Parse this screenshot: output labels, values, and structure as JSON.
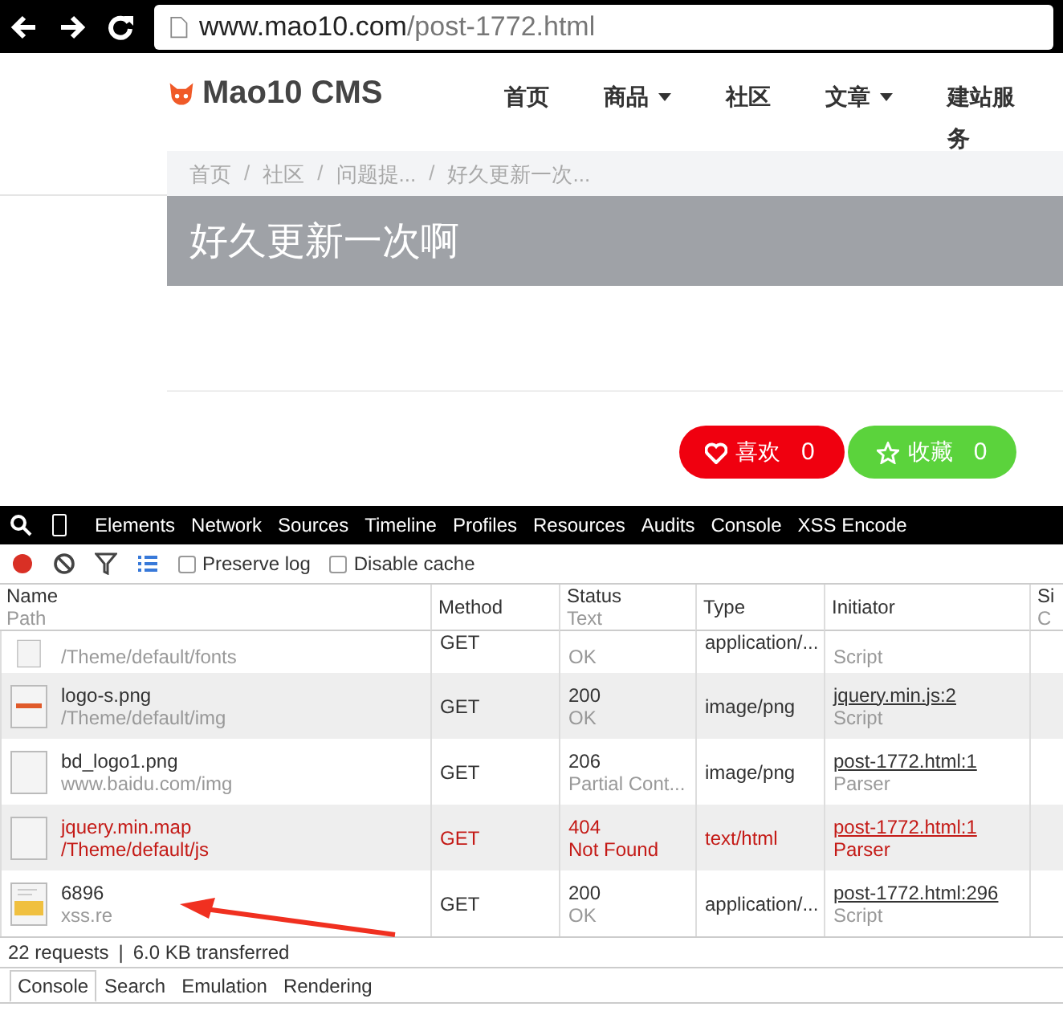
{
  "browser": {
    "url_host": "www.mao10.com",
    "url_path": "/post-1772.html"
  },
  "site": {
    "logo_text": "Mao10 CMS",
    "nav": [
      {
        "label": "首页",
        "has_menu": false
      },
      {
        "label": "商品",
        "has_menu": true
      },
      {
        "label": "社区",
        "has_menu": false
      },
      {
        "label": "文章",
        "has_menu": true
      },
      {
        "label": "建站服务",
        "has_menu": false
      }
    ],
    "breadcrumb": [
      "首页",
      "社区",
      "问题提...",
      "好久更新一次..."
    ],
    "breadcrumb_separators": [
      "/",
      "/",
      "/"
    ],
    "title": "好久更新一次啊",
    "actions": [
      {
        "kind": "like",
        "label": "喜欢",
        "count": "0"
      },
      {
        "kind": "favorite",
        "label": "收藏",
        "count": "0"
      }
    ]
  },
  "devtools": {
    "panels": [
      "Elements",
      "Network",
      "Sources",
      "Timeline",
      "Profiles",
      "Resources",
      "Audits",
      "Console",
      "XSS Encode"
    ],
    "options": [
      {
        "label": "Preserve log",
        "checked": false
      },
      {
        "label": "Disable cache",
        "checked": false
      }
    ],
    "columns": [
      {
        "title": "Name",
        "subtitle": "Path"
      },
      {
        "title": "Method"
      },
      {
        "title": "Status",
        "subtitle": "Text"
      },
      {
        "title": "Type"
      },
      {
        "title": "Initiator"
      },
      {
        "title": "Si",
        "subtitle": "C"
      }
    ],
    "rows": [
      {
        "kind": "file",
        "partial": true,
        "name": "",
        "path": "/Theme/default/fonts",
        "method": "GET",
        "status": "",
        "status_text": "OK",
        "type": "application/...",
        "initiator": "",
        "initiator_kind": "Script",
        "error": false
      },
      {
        "kind": "image",
        "partial": false,
        "name": "logo-s.png",
        "path": "/Theme/default/img",
        "method": "GET",
        "status": "200",
        "status_text": "OK",
        "type": "image/png",
        "initiator": "jquery.min.js:2",
        "initiator_kind": "Script",
        "error": false
      },
      {
        "kind": "file",
        "partial": false,
        "name": "bd_logo1.png",
        "path": "www.baidu.com/img",
        "method": "GET",
        "status": "206",
        "status_text": "Partial Cont...",
        "type": "image/png",
        "initiator": "post-1772.html:1",
        "initiator_kind": "Parser",
        "error": false
      },
      {
        "kind": "file",
        "partial": false,
        "name": "jquery.min.map",
        "path": "/Theme/default/js",
        "method": "GET",
        "status": "404",
        "status_text": "Not Found",
        "type": "text/html",
        "initiator": "post-1772.html:1",
        "initiator_kind": "Parser",
        "error": true
      },
      {
        "kind": "script",
        "partial": false,
        "name": "6896",
        "path": "xss.re",
        "method": "GET",
        "status": "200",
        "status_text": "OK",
        "type": "application/...",
        "initiator": "post-1772.html:296",
        "initiator_kind": "Script",
        "error": false
      }
    ],
    "summary": [
      "22 requests",
      "|",
      "6.0 KB transferred"
    ],
    "drawer_tabs": [
      {
        "label": "Console",
        "selected": true
      },
      {
        "label": "Search",
        "selected": false
      },
      {
        "label": "Emulation",
        "selected": false
      },
      {
        "label": "Rendering",
        "selected": false
      }
    ]
  }
}
